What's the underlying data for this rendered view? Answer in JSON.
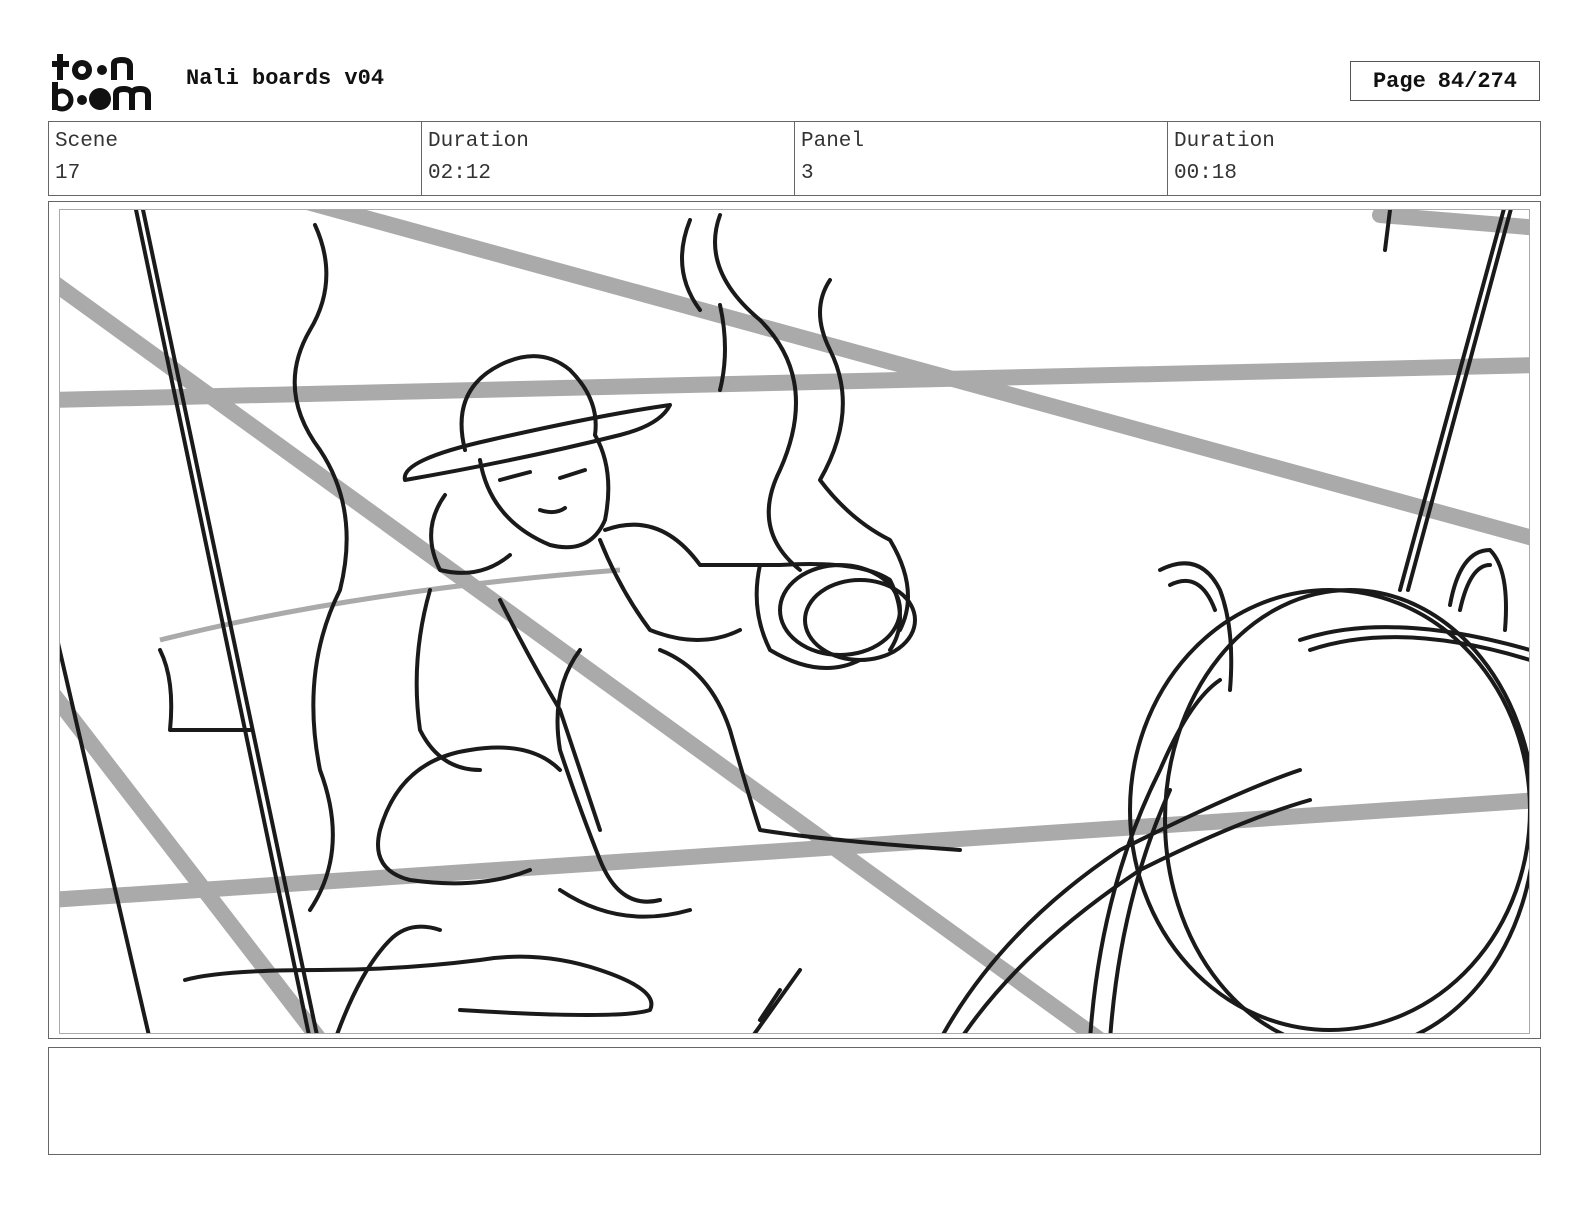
{
  "header": {
    "logo_text_top": "toon",
    "logo_text_bottom": "boom",
    "title": "Nali boards v04",
    "page_label": "Page",
    "page_value": "84/274"
  },
  "info": {
    "scene_label": "Scene",
    "scene_value": "17",
    "scene_duration_label": "Duration",
    "scene_duration_value": "02:12",
    "panel_label": "Panel",
    "panel_value": "3",
    "panel_duration_label": "Duration",
    "panel_duration_value": "00:18"
  },
  "notes": {
    "text": ""
  }
}
